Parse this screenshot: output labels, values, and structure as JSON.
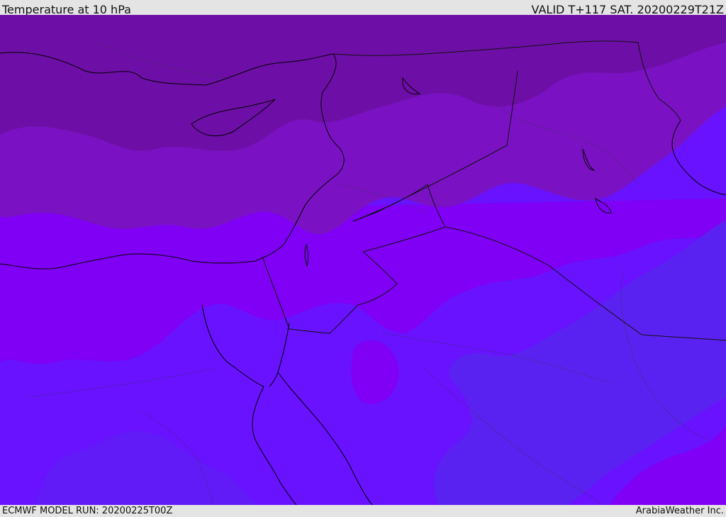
{
  "header": {
    "title": "Temperature at 10 hPa",
    "valid_time": "VALID T+117 SAT. 20200229T21Z"
  },
  "footer": {
    "model_run": "ECMWF MODEL RUN: 20200225T00Z",
    "credit": "ArabiaWeather Inc."
  },
  "map": {
    "region": "Eastern Mediterranean, Egypt, Levant, Iraq, Arabian Peninsula",
    "variable": "Temperature at 10 hPa",
    "colors": {
      "coldest_band": "#6d0fa6",
      "cold_band": "#7a12c4",
      "mid_band": "#8000f5",
      "warm_band": "#6812ff",
      "warmest_band": "#5a22f0",
      "coastline": "#000000",
      "borders": "#222222"
    }
  }
}
